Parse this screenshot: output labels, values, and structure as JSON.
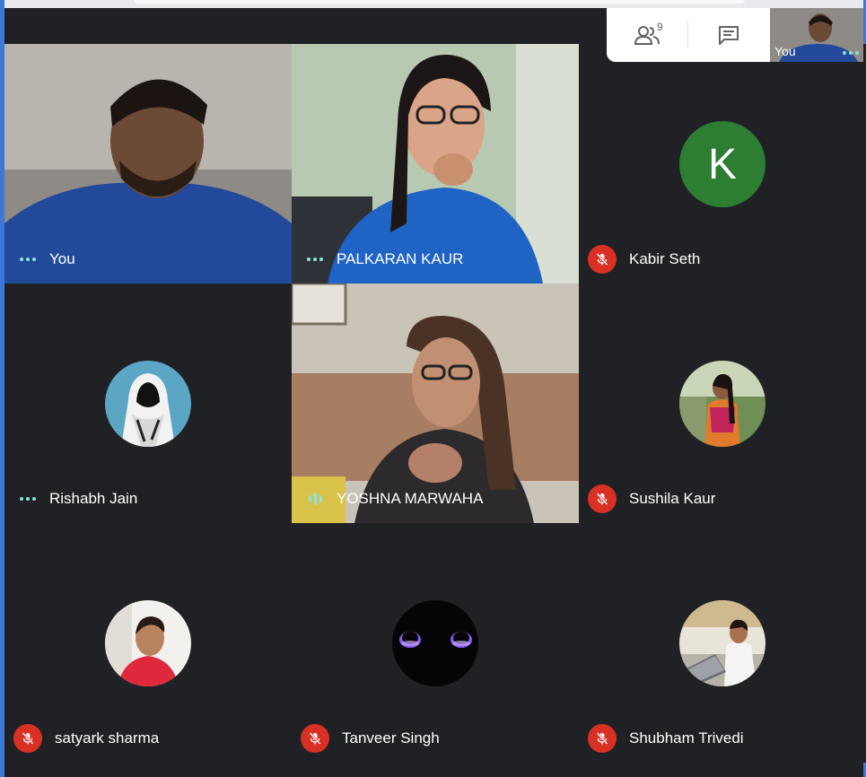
{
  "top_bar": {
    "participants_count": "9",
    "participants_icon": "people-icon",
    "chat_icon": "chat-icon",
    "self_view_label": "You"
  },
  "tiles": [
    {
      "name": "You",
      "type": "video",
      "status": "more-options-dots"
    },
    {
      "name": "PALKARAN KAUR",
      "type": "video",
      "status": "more-options-dots"
    },
    {
      "name": "Kabir Seth",
      "type": "avatar",
      "avatar_letter": "K",
      "status": "muted"
    },
    {
      "name": "Rishabh Jain",
      "type": "avatar",
      "status": "more-options-dots"
    },
    {
      "name": "YOSHNA MARWAHA",
      "type": "video",
      "status": "speaking"
    },
    {
      "name": "Sushila Kaur",
      "type": "avatar",
      "status": "muted"
    },
    {
      "name": "satyark sharma",
      "type": "avatar",
      "status": "muted"
    },
    {
      "name": "Tanveer Singh",
      "type": "avatar",
      "status": "muted"
    },
    {
      "name": "Shubham Trivedi",
      "type": "avatar",
      "status": "muted"
    }
  ],
  "colors": {
    "background": "#202124",
    "mute_red": "#d93025",
    "indicator_teal": "#8ee3d8",
    "avatar_green": "#2d7d32",
    "window_border": "#3c78d8"
  }
}
